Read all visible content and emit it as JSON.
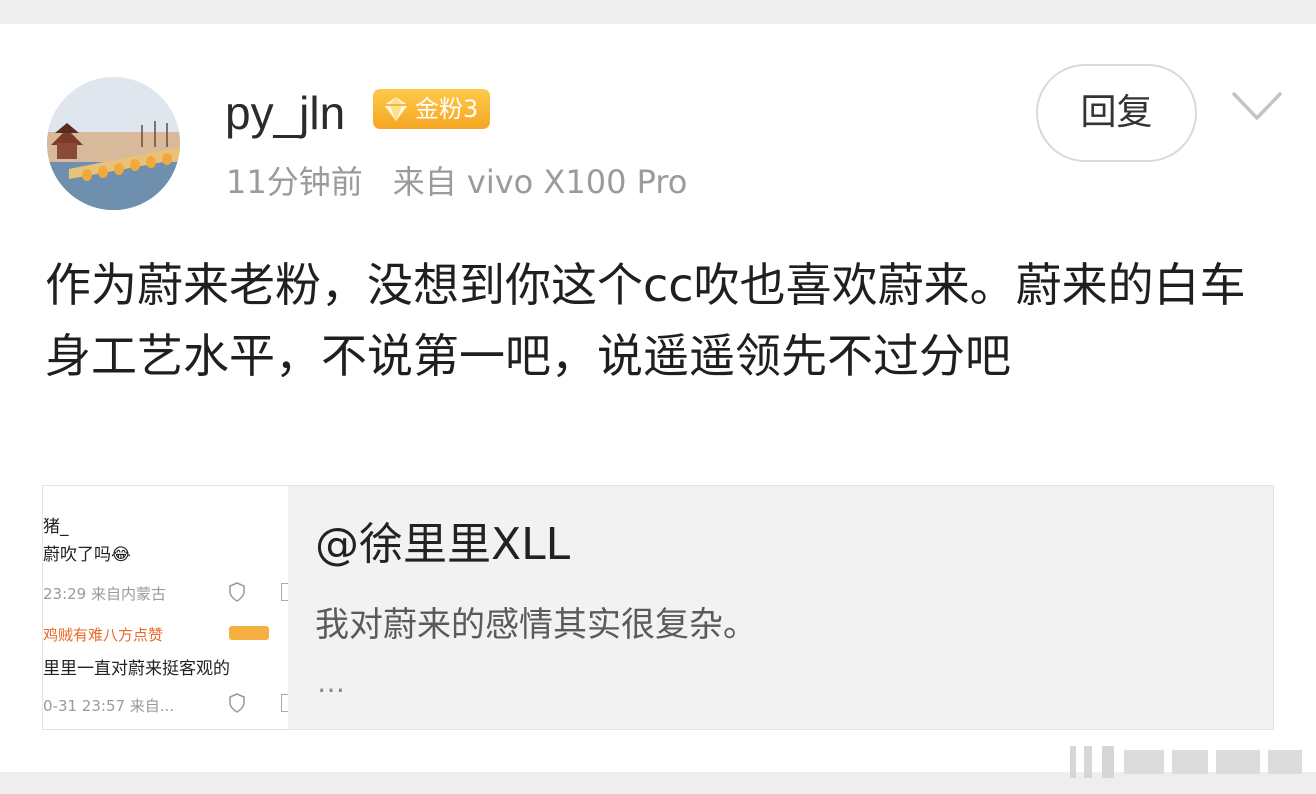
{
  "post": {
    "username": "py_jln",
    "badge_label": "金粉3",
    "time": "11分钟前",
    "source": "来自 vivo X100 Pro",
    "reply_label": "回复",
    "content": "作为蔚来老粉，没想到你这个cc吹也喜欢蔚来。蔚来的白车身工艺水平，不说第一吧，说遥遥领先不过分吧"
  },
  "quote": {
    "author": "@徐里里XLL",
    "text": "我对蔚来的感情其实很复杂。",
    "ellipsis": "…",
    "thumbnail": {
      "line1": "猪_",
      "line2": "蔚吹了吗😂",
      "line3": "23:29 来自内蒙古",
      "line4": "鸡贼有难八方点赞",
      "line5": "里里一直对蔚来挺客观的",
      "line6": "0-31 23:57 来自..."
    }
  },
  "colors": {
    "badge": "#f5a623",
    "card_background": "#ffffff",
    "page_background": "#eeeeee",
    "quote_background": "#f2f2f2"
  }
}
